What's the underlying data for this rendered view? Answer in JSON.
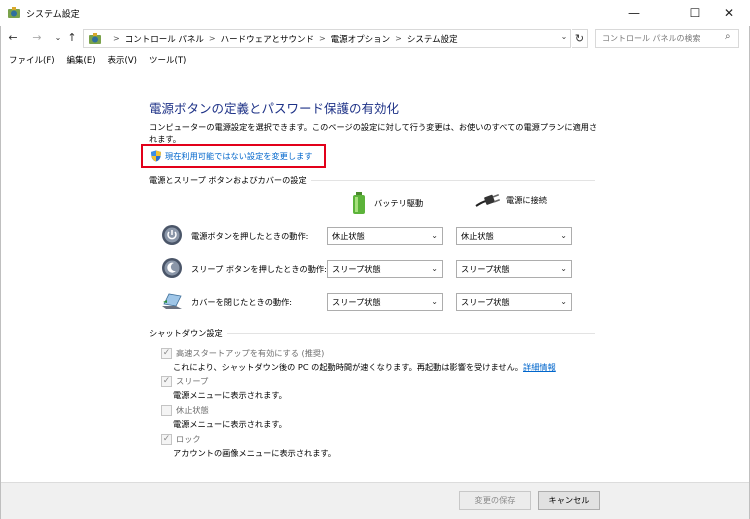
{
  "window": {
    "title": "システム設定",
    "controls": {
      "minimize": "—",
      "maximize": "☐",
      "close": "✕"
    }
  },
  "nav": {
    "back": "←",
    "forward": "→",
    "recent": "⌄",
    "up": "↑",
    "refresh": "↻",
    "dropdown": "⌄"
  },
  "address": {
    "breadcrumbs": [
      "コントロール パネル",
      "ハードウェアとサウンド",
      "電源オプション",
      "システム設定"
    ],
    "separator": ">"
  },
  "search": {
    "placeholder": "コントロール パネルの検索",
    "icon": "⌕"
  },
  "menu": [
    "ファイル(F)",
    "編集(E)",
    "表示(V)",
    "ツール(T)"
  ],
  "page": {
    "heading": "電源ボタンの定義とパスワード保護の有効化",
    "description": "コンピューターの電源設定を選択できます。このページの設定に対して行う変更は、お使いのすべての電源プランに適用されます。",
    "change_link": "現在利用可能ではない設定を変更します"
  },
  "power_section": {
    "label": "電源とスリープ ボタンおよびカバーの設定",
    "columns": {
      "battery": "バッテリ駆動",
      "plugged": "電源に接続"
    },
    "rows": [
      {
        "label": "電源ボタンを押したときの動作:",
        "icon": "power-button-icon",
        "battery": "休止状態",
        "plugged": "休止状態"
      },
      {
        "label": "スリープ ボタンを押したときの動作:",
        "icon": "sleep-button-icon",
        "battery": "スリープ状態",
        "plugged": "スリープ状態"
      },
      {
        "label": "カバーを閉じたときの動作:",
        "icon": "laptop-lid-icon",
        "battery": "スリープ状態",
        "plugged": "スリープ状態"
      }
    ]
  },
  "shutdown_section": {
    "label": "シャットダウン設定",
    "items": [
      {
        "label": "高速スタートアップを有効にする (推奨)",
        "checked": true,
        "desc": "これにより、シャットダウン後の PC の起動時間が速くなります。再起動は影響を受けません。",
        "link": "詳細情報"
      },
      {
        "label": "スリープ",
        "checked": true,
        "desc": "電源メニューに表示されます。"
      },
      {
        "label": "休止状態",
        "checked": false,
        "desc": "電源メニューに表示されます。"
      },
      {
        "label": "ロック",
        "checked": true,
        "desc": "アカウントの画像メニューに表示されます。"
      }
    ]
  },
  "buttons": {
    "save": "変更の保存",
    "cancel": "キャンセル"
  },
  "colors": {
    "heading": "#1e3287",
    "link": "#0066cc",
    "highlight": "#e2001a"
  }
}
